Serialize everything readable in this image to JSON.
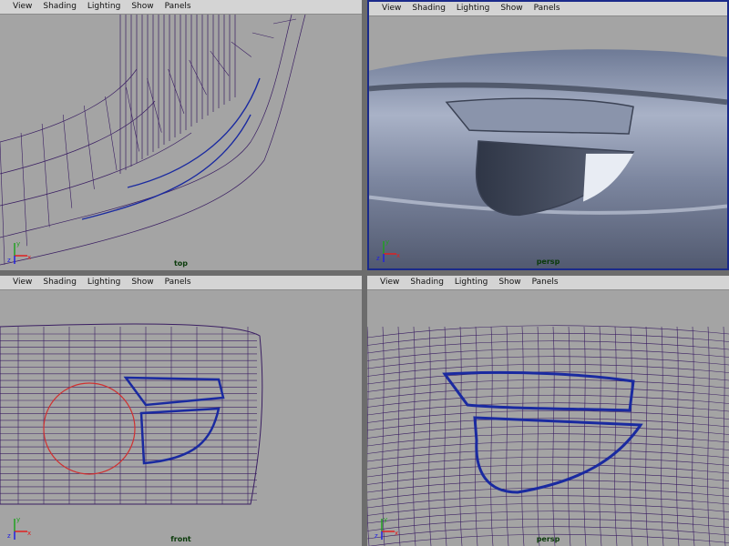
{
  "menu": [
    "View",
    "Shading",
    "Lighting",
    "Show",
    "Panels"
  ],
  "panels": {
    "top_left": {
      "camera": "top"
    },
    "top_right": {
      "camera": "persp"
    },
    "bottom_left": {
      "camera": "front"
    },
    "bottom_right": {
      "camera": "persp"
    }
  },
  "axis_labels": {
    "x": "x",
    "y": "y",
    "z": "z"
  },
  "colors": {
    "viewport_bg": "#a4a4a4",
    "wire": "#3a1e62",
    "selected_wire": "#1a2aa0",
    "active_border": "#1a2a8a",
    "manipulator": "#d03030",
    "axis_x": "#e02020",
    "axis_y": "#20a020",
    "axis_z": "#2020e0"
  }
}
